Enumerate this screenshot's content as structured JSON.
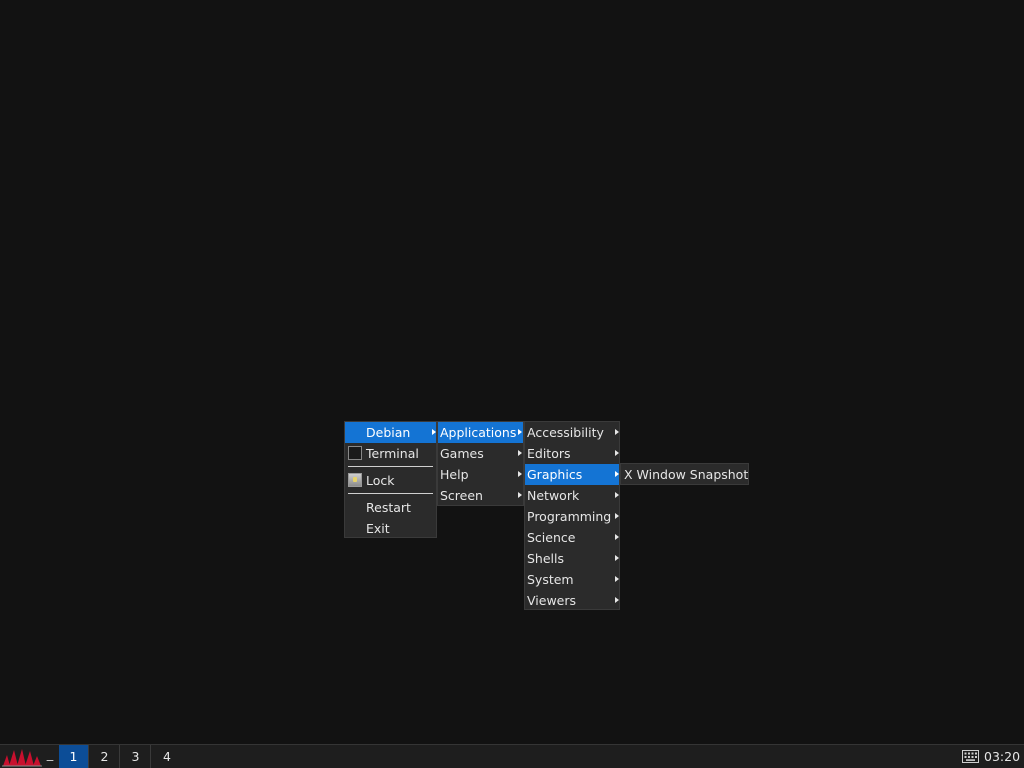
{
  "root_menu": {
    "items": [
      {
        "label": "Debian"
      },
      {
        "label": "Terminal"
      },
      {
        "label": "Lock"
      },
      {
        "label": "Restart"
      },
      {
        "label": "Exit"
      }
    ]
  },
  "applications_menu": {
    "items": [
      {
        "label": "Applications"
      },
      {
        "label": "Games"
      },
      {
        "label": "Help"
      },
      {
        "label": "Screen"
      }
    ]
  },
  "categories_menu": {
    "items": [
      {
        "label": "Accessibility"
      },
      {
        "label": "Editors"
      },
      {
        "label": "Graphics"
      },
      {
        "label": "Network"
      },
      {
        "label": "Programming"
      },
      {
        "label": "Science"
      },
      {
        "label": "Shells"
      },
      {
        "label": "System"
      },
      {
        "label": "Viewers"
      }
    ]
  },
  "graphics_menu": {
    "items": [
      {
        "label": "X Window Snapshot"
      }
    ]
  },
  "taskbar": {
    "minimize_label": "_",
    "workspaces": [
      "1",
      "2",
      "3",
      "4"
    ],
    "active_workspace": "1",
    "clock": "03:20",
    "icons": {
      "start": "jwm-logo-icon",
      "keyboard": "keyboard-icon"
    }
  },
  "colors": {
    "desktop": "#121212",
    "menu_bg": "#2b2b2b",
    "highlight": "#1474d4",
    "workspace_active": "#0c4d97"
  }
}
